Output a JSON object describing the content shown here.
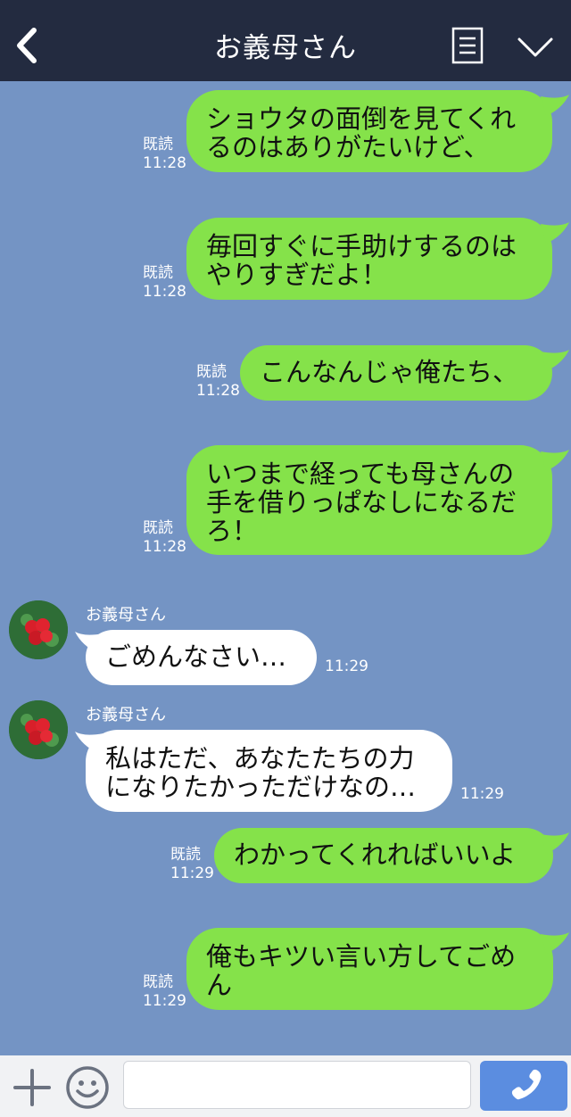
{
  "header": {
    "title": "お義母さん"
  },
  "colors": {
    "background": "#7494c4",
    "header": "#232b40",
    "sent_bubble": "#85e24a",
    "received_bubble": "#ffffff",
    "call_button": "#5b8de0"
  },
  "messages": [
    {
      "direction": "sent",
      "lines": [
        "ショウタの面倒を見てくれ",
        "るのはありがたいけど、"
      ],
      "read": "既読",
      "time": "11:28"
    },
    {
      "direction": "sent",
      "lines": [
        "毎回すぐに手助けするのは",
        "やりすぎだよ！"
      ],
      "read": "既読",
      "time": "11:28"
    },
    {
      "direction": "sent",
      "lines": [
        "こんなんじゃ俺たち、"
      ],
      "read": "既読",
      "time": "11:28"
    },
    {
      "direction": "sent",
      "lines": [
        "いつまで経っても母さんの",
        "手を借りっぱなしになるだ",
        "ろ！"
      ],
      "read": "既読",
      "time": "11:28"
    },
    {
      "direction": "received",
      "sender": "お義母さん",
      "lines": [
        "ごめんなさい…"
      ],
      "time": "11:29"
    },
    {
      "direction": "received",
      "sender": "お義母さん",
      "lines": [
        "私はただ、あなたたちの力",
        "になりたかっただけなの…"
      ],
      "time": "11:29"
    },
    {
      "direction": "sent",
      "lines": [
        "わかってくれればいいよ"
      ],
      "read": "既読",
      "time": "11:29"
    },
    {
      "direction": "sent",
      "lines": [
        "俺もキツい言い方してごめ",
        "ん"
      ],
      "read": "既読",
      "time": "11:29"
    }
  ],
  "icons": {
    "back": "chevron-left-icon",
    "menu": "menu-list-icon",
    "collapse": "chevron-down-icon",
    "add": "plus-icon",
    "emoji": "smiley-icon",
    "call": "phone-icon"
  }
}
